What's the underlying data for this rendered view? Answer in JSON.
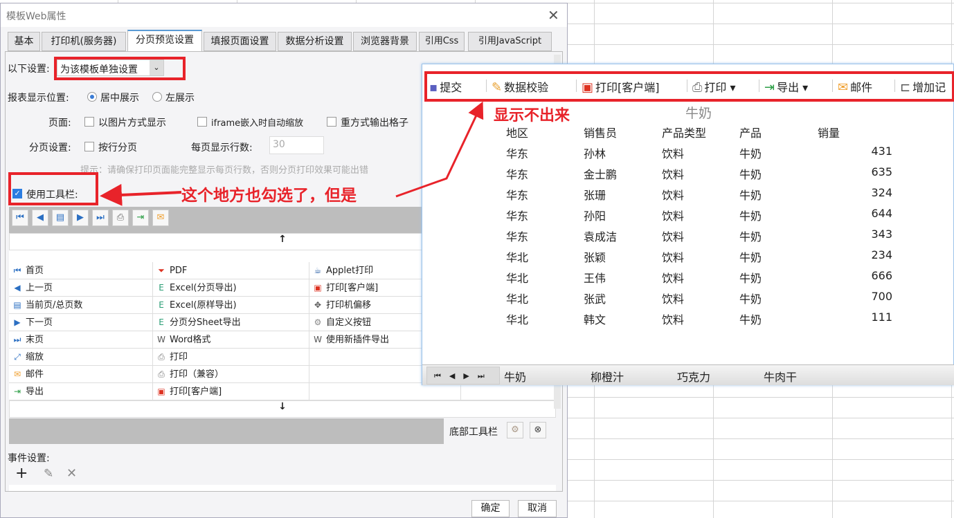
{
  "dialog": {
    "title": "模板Web属性",
    "close": "✕",
    "tabs": [
      "基本",
      "打印机(服务器)",
      "分页预览设置",
      "填报页面设置",
      "数据分析设置",
      "浏览器背景",
      "引用Css",
      "引用JavaScript"
    ],
    "active_tab": "分页预览设置",
    "settings_label": "以下设置:",
    "settings_value": "为该模板单独设置",
    "position_label": "报表显示位置:",
    "position_options": [
      "居中展示",
      "左展示"
    ],
    "position_selected": "居中展示",
    "page_label": "页面:",
    "page_options": [
      "以图片方式显示",
      "iframe嵌入时自动缩放",
      "重方式输出格子"
    ],
    "paging_label": "分页设置:",
    "paging_option": "按行分页",
    "rows_label": "每页显示行数:",
    "rows_value": "30",
    "hint": "提示：请确保打印页面能完整显示每页行数，否则分页打印效果可能出错",
    "toolbar_label": "使用工具栏:",
    "toolbar_checked": true,
    "up_arrow": "↑",
    "down_arrow": "↓",
    "items": [
      [
        {
          "icon": "first-page-icon",
          "g": "⏮",
          "c": "#2b6fc2",
          "label": "首页"
        },
        {
          "icon": "pdf-icon",
          "g": "⏷",
          "c": "#d32",
          "label": "PDF"
        },
        {
          "icon": "applet-print-icon",
          "g": "☕",
          "c": "#36a",
          "label": "Applet打印"
        }
      ],
      [
        {
          "icon": "prev-page-icon",
          "g": "◀",
          "c": "#2b6fc2",
          "label": "上一页"
        },
        {
          "icon": "excel-icon",
          "g": "E",
          "c": "#2a9d74",
          "label": "Excel(分页导出)"
        },
        {
          "icon": "client-print-icon",
          "g": "▣",
          "c": "#d32",
          "label": "打印[客户端]"
        }
      ],
      [
        {
          "icon": "page-count-icon",
          "g": "▤",
          "c": "#2b6fc2",
          "label": "当前页/总页数"
        },
        {
          "icon": "excel-icon",
          "g": "E",
          "c": "#2a9d74",
          "label": "Excel(原样导出)"
        },
        {
          "icon": "printer-offset-icon",
          "g": "✥",
          "c": "#555",
          "label": "打印机偏移"
        }
      ],
      [
        {
          "icon": "next-page-icon",
          "g": "▶",
          "c": "#2b6fc2",
          "label": "下一页"
        },
        {
          "icon": "excel-icon",
          "g": "E",
          "c": "#2a9d74",
          "label": "分页分Sheet导出"
        },
        {
          "icon": "gear-icon",
          "g": "⚙",
          "c": "#888",
          "label": "自定义按钮"
        }
      ],
      [
        {
          "icon": "last-page-icon",
          "g": "⏭",
          "c": "#2b6fc2",
          "label": "末页"
        },
        {
          "icon": "word-icon",
          "g": "W",
          "c": "#555",
          "label": "Word格式"
        },
        {
          "icon": "word-icon",
          "g": "W",
          "c": "#555",
          "label": "使用新插件导出"
        }
      ],
      [
        {
          "icon": "zoom-icon",
          "g": "⤢",
          "c": "#2b6fc2",
          "label": "缩放"
        },
        {
          "icon": "printer-icon",
          "g": "⎙",
          "c": "#777",
          "label": "打印"
        },
        null
      ],
      [
        {
          "icon": "mail-icon",
          "g": "✉",
          "c": "#f0a030",
          "label": "邮件"
        },
        {
          "icon": "printer-icon",
          "g": "⎙",
          "c": "#777",
          "label": "打印（兼容）"
        },
        null
      ],
      [
        {
          "icon": "export-icon",
          "g": "⇥",
          "c": "#2a9d44",
          "label": "导出"
        },
        {
          "icon": "flash-print-icon",
          "g": "▣",
          "c": "#d32",
          "label": "打印[客户端]"
        },
        null
      ]
    ],
    "bottom_toolbar_label": "底部工具栏",
    "event_label": "事件设置:",
    "ok": "确定",
    "cancel": "取消"
  },
  "annotations": {
    "checked_note": "这个地方也勾选了，但是",
    "not_shown": "显示不出来"
  },
  "preview": {
    "toolbar": [
      {
        "icon": "save-icon",
        "label": "提交"
      },
      {
        "icon": "validate-icon",
        "label": "数据校验"
      },
      {
        "icon": "flash-print-icon",
        "label": "打印[客户端]"
      },
      {
        "icon": "printer-icon",
        "label": "打印 ▾"
      },
      {
        "icon": "export-icon",
        "label": "导出 ▾"
      },
      {
        "icon": "mail-icon",
        "label": "邮件"
      },
      {
        "icon": "add-row-icon",
        "label": "增加记"
      }
    ],
    "report_title": "牛奶",
    "headers": [
      "地区",
      "销售员",
      "产品类型",
      "产品",
      "销量"
    ],
    "rows": [
      [
        "华东",
        "孙林",
        "饮料",
        "牛奶",
        "431"
      ],
      [
        "华东",
        "金士鹏",
        "饮料",
        "牛奶",
        "635"
      ],
      [
        "华东",
        "张珊",
        "饮料",
        "牛奶",
        "324"
      ],
      [
        "华东",
        "孙阳",
        "饮料",
        "牛奶",
        "644"
      ],
      [
        "华东",
        "袁成洁",
        "饮料",
        "牛奶",
        "343"
      ],
      [
        "华北",
        "张颖",
        "饮料",
        "牛奶",
        "234"
      ],
      [
        "华北",
        "王伟",
        "饮料",
        "牛奶",
        "666"
      ],
      [
        "华北",
        "张武",
        "饮料",
        "牛奶",
        "700"
      ],
      [
        "华北",
        "韩文",
        "饮料",
        "牛奶",
        "111"
      ]
    ],
    "sheets": [
      "牛奶",
      "柳橙汁",
      "巧克力",
      "牛肉干"
    ]
  }
}
